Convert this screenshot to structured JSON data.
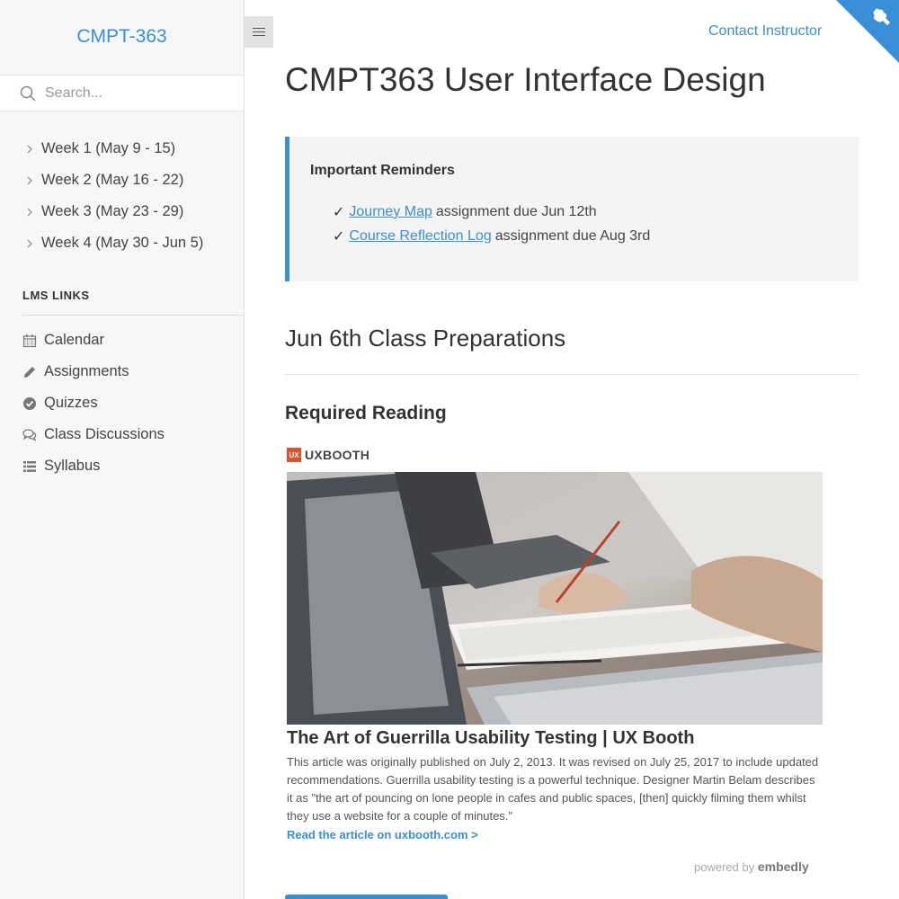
{
  "sidebar": {
    "site_title": "CMPT-363",
    "search_placeholder": "Search...",
    "weeks": [
      {
        "label": "Week 1 (May 9 - 15)"
      },
      {
        "label": "Week 2 (May 16 - 22)"
      },
      {
        "label": "Week 3 (May 23 - 29)"
      },
      {
        "label": "Week 4 (May 30 - Jun 5)"
      }
    ],
    "lms_header": "LMS LINKS",
    "lms_links": [
      {
        "label": "Calendar",
        "icon": "calendar-icon"
      },
      {
        "label": "Assignments",
        "icon": "pencil-icon"
      },
      {
        "label": "Quizzes",
        "icon": "check-circle-icon"
      },
      {
        "label": "Class Discussions",
        "icon": "comments-icon"
      },
      {
        "label": "Syllabus",
        "icon": "list-icon"
      }
    ]
  },
  "header": {
    "contact_label": "Contact Instructor"
  },
  "main": {
    "title": "CMPT363 User Interface Design",
    "reminders": {
      "title": "Important Reminders",
      "items": [
        {
          "check": "✓",
          "link": "Journey Map",
          "text": "assignment due Jun 12th"
        },
        {
          "check": "✓",
          "link": "Course Reflection Log",
          "text": "assignment due Aug 3rd"
        }
      ]
    },
    "section_title": "Jun 6th Class Preparations",
    "subsection_title": "Required Reading",
    "embed": {
      "provider_logo": "UX",
      "provider": "UXBOOTH",
      "title": "The Art of Guerrilla Usability Testing | UX Booth",
      "description": "This article was originally published on July 2, 2013. It was revised on July 25, 2017 to include updated recommendations. Guerrilla usability testing is a powerful technique. Designer Martin Belam describes it as \"the art of pouncing on lone people in cafes and public spaces, [then] quickly filming them whilst they use a website for a couple of minutes.\"",
      "link_label": "Read the article on uxbooth.com >",
      "powered_prefix": "powered by ",
      "powered_brand": "embedly"
    }
  },
  "colors": {
    "accent": "#3a8fd6",
    "sidebar_bg": "#f7f7f7",
    "reminder_bg": "#f4f4f4"
  }
}
